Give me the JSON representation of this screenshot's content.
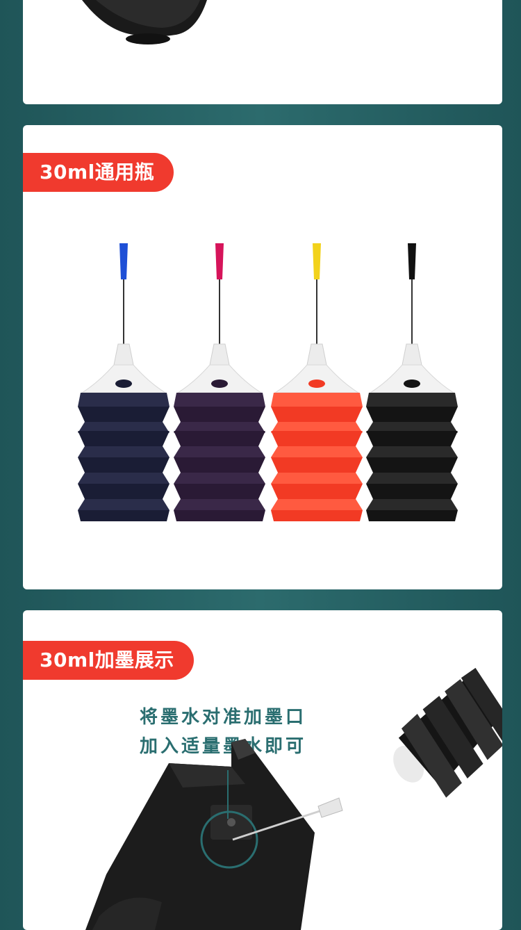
{
  "sections": [
    {
      "id": "bottle-bottom",
      "label": ""
    },
    {
      "id": "universal-bottle",
      "label": "30ml通用瓶"
    },
    {
      "id": "refill-demo",
      "label": "30ml加墨展示",
      "instructions": [
        "将墨水对准加墨口",
        "加入适量墨水即可"
      ]
    }
  ],
  "bottles": [
    {
      "color_name": "cyan",
      "tip": "#1e4fd6",
      "ink": "#1a1d35",
      "band": "#2a2d4a"
    },
    {
      "color_name": "magenta",
      "tip": "#d6145a",
      "ink": "#2a1a35",
      "band": "#3a2848"
    },
    {
      "color_name": "yellow",
      "tip": "#f2d21b",
      "ink": "#f23a24",
      "band": "#ff5a40"
    },
    {
      "color_name": "black",
      "tip": "#111111",
      "ink": "#141414",
      "band": "#2a2a2a"
    }
  ],
  "accent": "#f03a2e",
  "teal": "#2a6e70"
}
